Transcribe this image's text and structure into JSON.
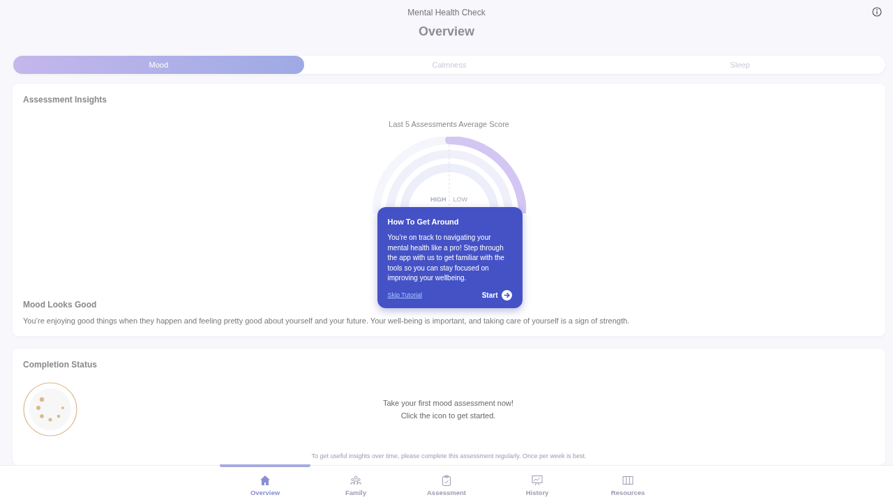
{
  "header": {
    "app_title": "Mental Health Check",
    "page_title": "Overview"
  },
  "tabs": [
    {
      "label": "Mood",
      "selected": true
    },
    {
      "label": "Calmness",
      "selected": false
    },
    {
      "label": "Sleep",
      "selected": false
    }
  ],
  "insights": {
    "title": "Assessment Insights",
    "gauge_title": "Last 5 Assessments Average Score",
    "high_label": "HIGH",
    "low_label": "LOW",
    "result_title": "Mood Looks Good",
    "result_text": "You’re enjoying good things when they happen and feeling pretty good about yourself and your future. Your well-being is important, and taking care of yourself is a sign of strength."
  },
  "tutorial": {
    "title": "How To Get Around",
    "text": "You’re on track to navigating your mental health like a pro! Step through the app with us to get familiar with the tools so you can stay focused on improving your wellbeing.",
    "skip": "Skip Tutorial",
    "start": "Start"
  },
  "completion": {
    "title": "Completion Status",
    "prompt_lines": [
      "Take your first mood assessment now!",
      "Click the icon to get started."
    ],
    "hint": "To get useful insights over time, please complete this assessment regularly. Once per week is best."
  },
  "nav": [
    {
      "label": "Overview",
      "kind": "home",
      "selected": true
    },
    {
      "label": "Family",
      "kind": "people",
      "selected": false
    },
    {
      "label": "Assessment",
      "kind": "clipboard",
      "selected": false
    },
    {
      "label": "History",
      "kind": "chart",
      "selected": false
    },
    {
      "label": "Resources",
      "kind": "columns",
      "selected": false
    }
  ]
}
